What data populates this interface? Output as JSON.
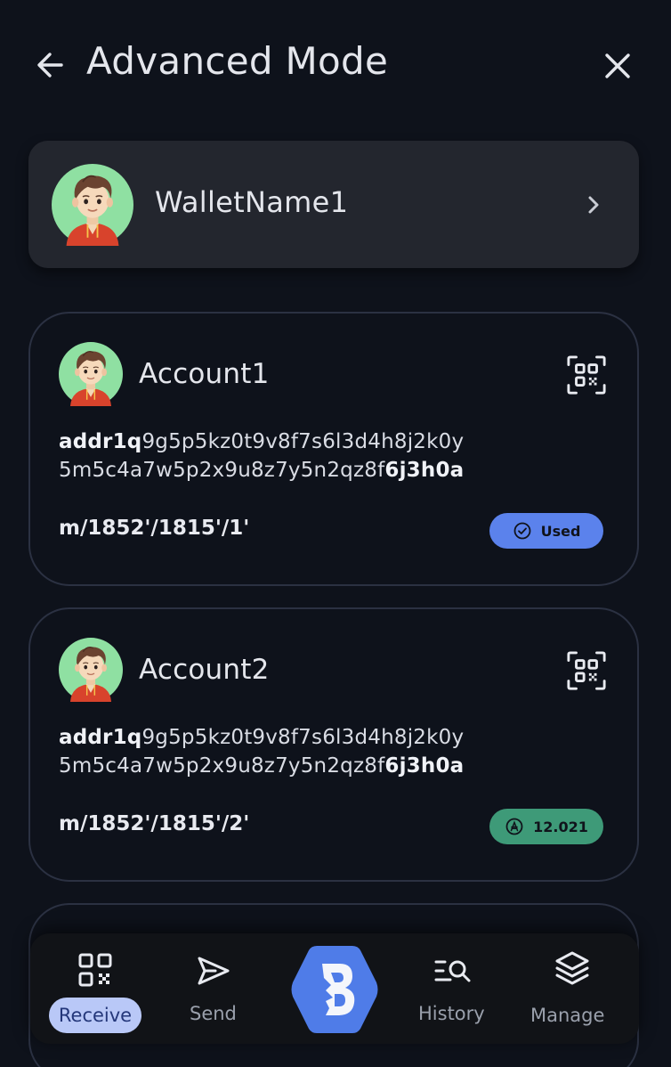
{
  "header": {
    "title": "Advanced Mode",
    "back_icon": "arrow-left-icon",
    "close_icon": "close-icon"
  },
  "wallet": {
    "name": "WalletName1",
    "chevron_icon": "chevron-right-icon"
  },
  "accounts": [
    {
      "name": "Account1",
      "address_prefix": "addr1q",
      "address_middle_1": "9g5p5kz0t9v8f7s6l3d4h8j2k0y",
      "address_middle_2": "5m5c4a7w5p2x9u8z7y5n2qz8f",
      "address_suffix": "6j3h0a",
      "path": "m/1852'/1815'/1'",
      "badge": "Used",
      "badge_color": "#5b82ec"
    },
    {
      "name": "Account2",
      "address_prefix": "addr1q",
      "address_middle_1": "9g5p5kz0t9v8f7s6l3d4h8j2k0y",
      "address_middle_2": "5m5c4a7w5p2x9u8z7y5n2qz8f",
      "address_suffix": "6j3h0a",
      "path": "m/1852'/1815'/2'",
      "badge": "12.021",
      "badge_color": "#3e9a78"
    }
  ],
  "nav": {
    "items": [
      {
        "label": "Receive",
        "icon": "qr-code-icon",
        "active": true
      },
      {
        "label": "Send",
        "icon": "send-icon",
        "active": false
      },
      {
        "label": "",
        "icon": "app-logo-icon",
        "active": false
      },
      {
        "label": "History",
        "icon": "history-search-icon",
        "active": false
      },
      {
        "label": "Manage",
        "icon": "layers-icon",
        "active": false
      }
    ],
    "active_color": "#b9c8f7",
    "logo_color": "#4f7ce8"
  },
  "colors": {
    "background": "#0e121b",
    "card": "#23262e",
    "card_border": "#2b3142"
  }
}
